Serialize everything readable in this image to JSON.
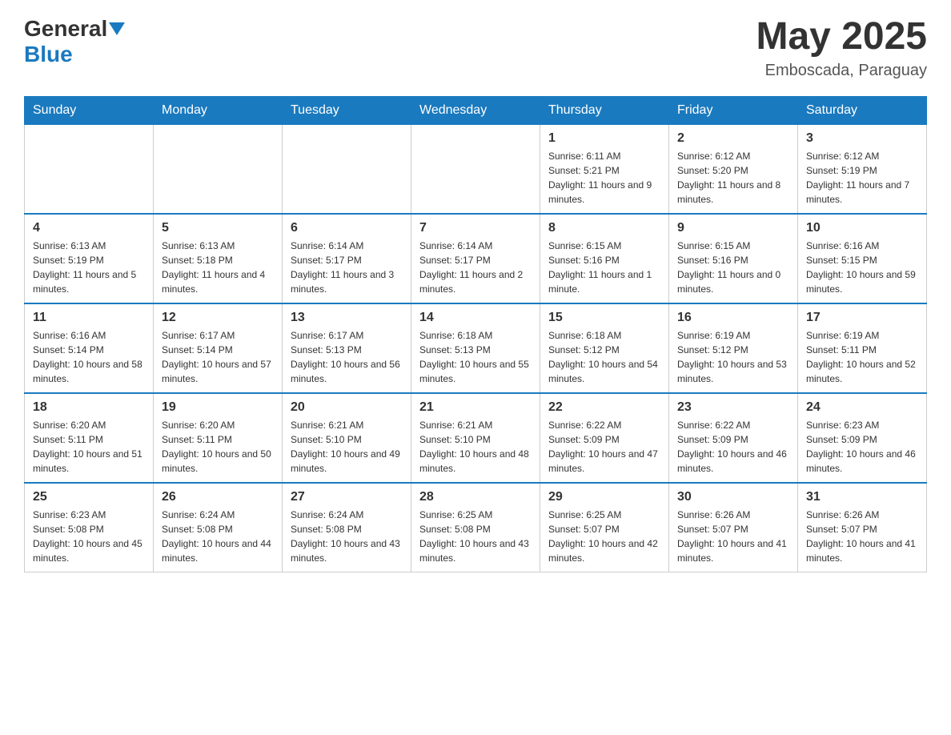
{
  "header": {
    "logo_general": "General",
    "logo_blue": "Blue",
    "month_title": "May 2025",
    "location": "Emboscada, Paraguay"
  },
  "weekdays": [
    "Sunday",
    "Monday",
    "Tuesday",
    "Wednesday",
    "Thursday",
    "Friday",
    "Saturday"
  ],
  "weeks": [
    [
      {
        "day": "",
        "sunrise": "",
        "sunset": "",
        "daylight": ""
      },
      {
        "day": "",
        "sunrise": "",
        "sunset": "",
        "daylight": ""
      },
      {
        "day": "",
        "sunrise": "",
        "sunset": "",
        "daylight": ""
      },
      {
        "day": "",
        "sunrise": "",
        "sunset": "",
        "daylight": ""
      },
      {
        "day": "1",
        "sunrise": "Sunrise: 6:11 AM",
        "sunset": "Sunset: 5:21 PM",
        "daylight": "Daylight: 11 hours and 9 minutes."
      },
      {
        "day": "2",
        "sunrise": "Sunrise: 6:12 AM",
        "sunset": "Sunset: 5:20 PM",
        "daylight": "Daylight: 11 hours and 8 minutes."
      },
      {
        "day": "3",
        "sunrise": "Sunrise: 6:12 AM",
        "sunset": "Sunset: 5:19 PM",
        "daylight": "Daylight: 11 hours and 7 minutes."
      }
    ],
    [
      {
        "day": "4",
        "sunrise": "Sunrise: 6:13 AM",
        "sunset": "Sunset: 5:19 PM",
        "daylight": "Daylight: 11 hours and 5 minutes."
      },
      {
        "day": "5",
        "sunrise": "Sunrise: 6:13 AM",
        "sunset": "Sunset: 5:18 PM",
        "daylight": "Daylight: 11 hours and 4 minutes."
      },
      {
        "day": "6",
        "sunrise": "Sunrise: 6:14 AM",
        "sunset": "Sunset: 5:17 PM",
        "daylight": "Daylight: 11 hours and 3 minutes."
      },
      {
        "day": "7",
        "sunrise": "Sunrise: 6:14 AM",
        "sunset": "Sunset: 5:17 PM",
        "daylight": "Daylight: 11 hours and 2 minutes."
      },
      {
        "day": "8",
        "sunrise": "Sunrise: 6:15 AM",
        "sunset": "Sunset: 5:16 PM",
        "daylight": "Daylight: 11 hours and 1 minute."
      },
      {
        "day": "9",
        "sunrise": "Sunrise: 6:15 AM",
        "sunset": "Sunset: 5:16 PM",
        "daylight": "Daylight: 11 hours and 0 minutes."
      },
      {
        "day": "10",
        "sunrise": "Sunrise: 6:16 AM",
        "sunset": "Sunset: 5:15 PM",
        "daylight": "Daylight: 10 hours and 59 minutes."
      }
    ],
    [
      {
        "day": "11",
        "sunrise": "Sunrise: 6:16 AM",
        "sunset": "Sunset: 5:14 PM",
        "daylight": "Daylight: 10 hours and 58 minutes."
      },
      {
        "day": "12",
        "sunrise": "Sunrise: 6:17 AM",
        "sunset": "Sunset: 5:14 PM",
        "daylight": "Daylight: 10 hours and 57 minutes."
      },
      {
        "day": "13",
        "sunrise": "Sunrise: 6:17 AM",
        "sunset": "Sunset: 5:13 PM",
        "daylight": "Daylight: 10 hours and 56 minutes."
      },
      {
        "day": "14",
        "sunrise": "Sunrise: 6:18 AM",
        "sunset": "Sunset: 5:13 PM",
        "daylight": "Daylight: 10 hours and 55 minutes."
      },
      {
        "day": "15",
        "sunrise": "Sunrise: 6:18 AM",
        "sunset": "Sunset: 5:12 PM",
        "daylight": "Daylight: 10 hours and 54 minutes."
      },
      {
        "day": "16",
        "sunrise": "Sunrise: 6:19 AM",
        "sunset": "Sunset: 5:12 PM",
        "daylight": "Daylight: 10 hours and 53 minutes."
      },
      {
        "day": "17",
        "sunrise": "Sunrise: 6:19 AM",
        "sunset": "Sunset: 5:11 PM",
        "daylight": "Daylight: 10 hours and 52 minutes."
      }
    ],
    [
      {
        "day": "18",
        "sunrise": "Sunrise: 6:20 AM",
        "sunset": "Sunset: 5:11 PM",
        "daylight": "Daylight: 10 hours and 51 minutes."
      },
      {
        "day": "19",
        "sunrise": "Sunrise: 6:20 AM",
        "sunset": "Sunset: 5:11 PM",
        "daylight": "Daylight: 10 hours and 50 minutes."
      },
      {
        "day": "20",
        "sunrise": "Sunrise: 6:21 AM",
        "sunset": "Sunset: 5:10 PM",
        "daylight": "Daylight: 10 hours and 49 minutes."
      },
      {
        "day": "21",
        "sunrise": "Sunrise: 6:21 AM",
        "sunset": "Sunset: 5:10 PM",
        "daylight": "Daylight: 10 hours and 48 minutes."
      },
      {
        "day": "22",
        "sunrise": "Sunrise: 6:22 AM",
        "sunset": "Sunset: 5:09 PM",
        "daylight": "Daylight: 10 hours and 47 minutes."
      },
      {
        "day": "23",
        "sunrise": "Sunrise: 6:22 AM",
        "sunset": "Sunset: 5:09 PM",
        "daylight": "Daylight: 10 hours and 46 minutes."
      },
      {
        "day": "24",
        "sunrise": "Sunrise: 6:23 AM",
        "sunset": "Sunset: 5:09 PM",
        "daylight": "Daylight: 10 hours and 46 minutes."
      }
    ],
    [
      {
        "day": "25",
        "sunrise": "Sunrise: 6:23 AM",
        "sunset": "Sunset: 5:08 PM",
        "daylight": "Daylight: 10 hours and 45 minutes."
      },
      {
        "day": "26",
        "sunrise": "Sunrise: 6:24 AM",
        "sunset": "Sunset: 5:08 PM",
        "daylight": "Daylight: 10 hours and 44 minutes."
      },
      {
        "day": "27",
        "sunrise": "Sunrise: 6:24 AM",
        "sunset": "Sunset: 5:08 PM",
        "daylight": "Daylight: 10 hours and 43 minutes."
      },
      {
        "day": "28",
        "sunrise": "Sunrise: 6:25 AM",
        "sunset": "Sunset: 5:08 PM",
        "daylight": "Daylight: 10 hours and 43 minutes."
      },
      {
        "day": "29",
        "sunrise": "Sunrise: 6:25 AM",
        "sunset": "Sunset: 5:07 PM",
        "daylight": "Daylight: 10 hours and 42 minutes."
      },
      {
        "day": "30",
        "sunrise": "Sunrise: 6:26 AM",
        "sunset": "Sunset: 5:07 PM",
        "daylight": "Daylight: 10 hours and 41 minutes."
      },
      {
        "day": "31",
        "sunrise": "Sunrise: 6:26 AM",
        "sunset": "Sunset: 5:07 PM",
        "daylight": "Daylight: 10 hours and 41 minutes."
      }
    ]
  ]
}
